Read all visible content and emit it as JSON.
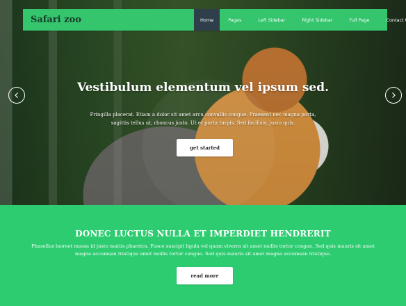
{
  "brand": "Safari zoo",
  "nav": [
    "Home",
    "Pages",
    "Left Sidebar",
    "Right Sidebar",
    "Full Page",
    "Contact Us"
  ],
  "hero": {
    "title": "Vestibulum elementum vel ipsum sed.",
    "text": "Fringilla placerat. Etiam a dolor sit amet arcu convallis congue. Praesent nec magna porta, sagittis tellus ut, rhoncus justo. Ut et porta turpis. Sed facilisis, justo quis.",
    "button": "get started"
  },
  "section": {
    "title": "DONEC LUCTUS NULLA ET IMPERDIET HENDRERIT",
    "text": "Phasellus laoreet massa id justo mattis pharetra. Fusce suscipit ligula vel quam viverra sit amet mollis tortor congue. Sed quis mauris sit amet magna accumsan tristique amet mollis tortor congue. Sed quis mauris sit amet magna accumsan tristique.",
    "button": "read more"
  },
  "colors": {
    "accent": "#2ecc71",
    "nav_active": "#2f3e4b",
    "brand_text": "#183b2a"
  },
  "icons": {
    "left_arrow": "chevron-left-icon",
    "right_arrow": "chevron-right-icon"
  }
}
